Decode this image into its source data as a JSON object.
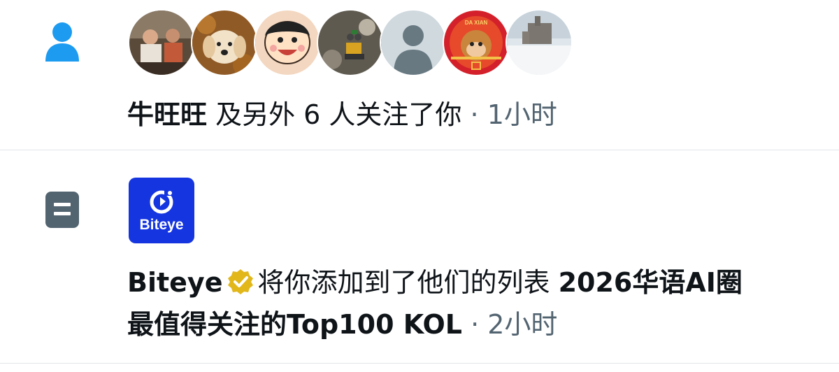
{
  "notifications": [
    {
      "type_icon": "person-icon",
      "avatars": [
        {
          "name": "photo-avatar-people"
        },
        {
          "name": "dog-avatar"
        },
        {
          "name": "cartoon-boy-avatar"
        },
        {
          "name": "robot-toy-avatar"
        },
        {
          "name": "default-avatar"
        },
        {
          "name": "monkey-king-avatar",
          "badge_text": "DA XIAN"
        },
        {
          "name": "snow-campus-avatar"
        }
      ],
      "actor": "牛旺旺",
      "text": " 及另外 6 人关注了你",
      "separator": " · ",
      "time": "1小时"
    },
    {
      "type_icon": "list-icon",
      "logo_text": "Biteye",
      "actor": "Biteye",
      "text": "将你添加到了他们的列表 ",
      "list_name_line1": "2026华语AI圈",
      "list_name_line2": "最值得关注的Top100 KOL",
      "separator": " · ",
      "time": "2小时"
    }
  ],
  "colors": {
    "accent": "#1d9bf0",
    "list_icon": "#536471",
    "muted_text": "#536471",
    "verified_gold": "#e2b719",
    "logo_bg": "#1535e0",
    "divider": "#e1e4e8"
  }
}
